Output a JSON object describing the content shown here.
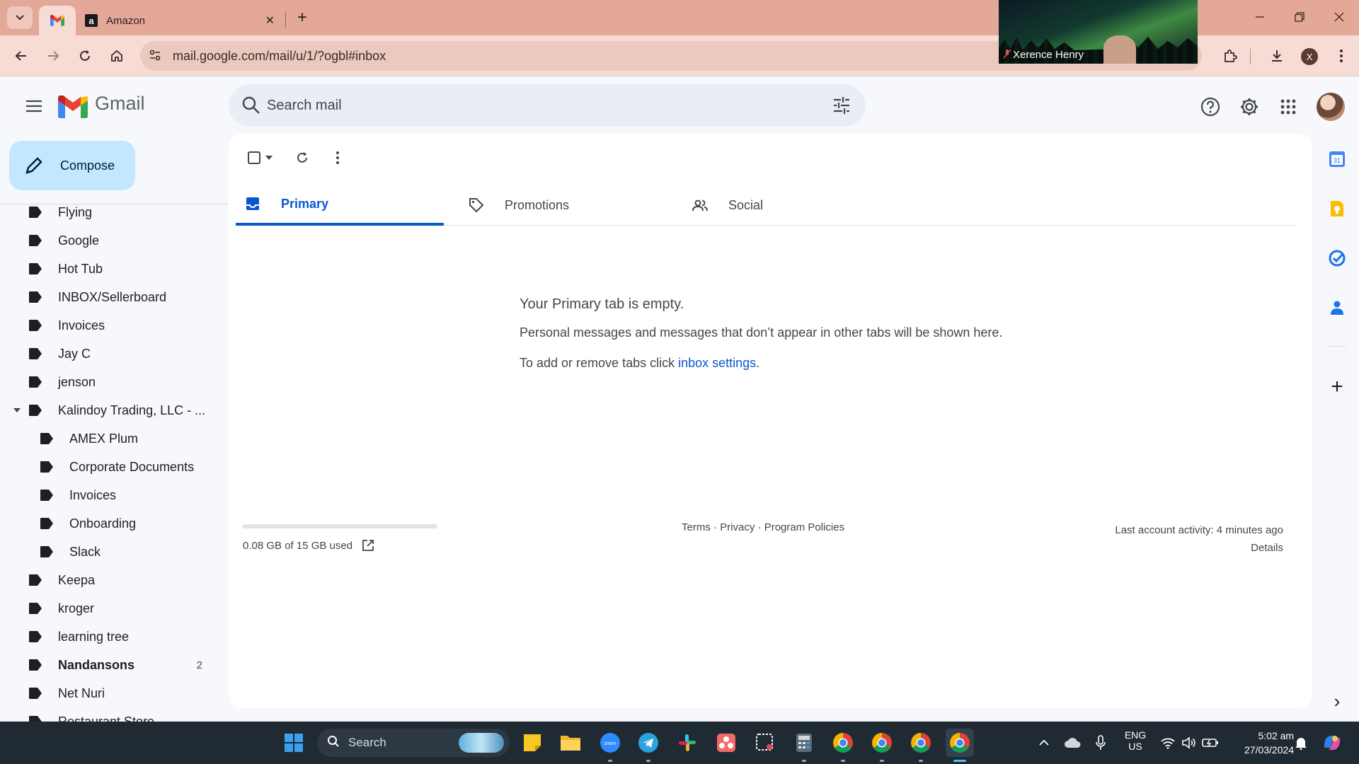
{
  "browser": {
    "tabs": [
      {
        "title": "",
        "favicon": "gmail-icon",
        "active": true
      },
      {
        "title": "Amazon",
        "favicon": "amazon-icon",
        "active": false
      }
    ],
    "tab_close": "✕",
    "new_tab": "+",
    "url": "mail.google.com/mail/u/1/?ogbl#inbox",
    "profile_initial": "X",
    "tab_color": "#e4a898",
    "toolbar_color": "#f6dcd4"
  },
  "video_call": {
    "participant": "Xerence Henry",
    "mic_status": "muted"
  },
  "gmail": {
    "product_name": "Gmail",
    "search_placeholder": "Search mail",
    "compose_label": "Compose",
    "labels": [
      {
        "name": "Flying",
        "count": "",
        "bold": false,
        "nested": false
      },
      {
        "name": "Google",
        "count": "",
        "bold": false,
        "nested": false
      },
      {
        "name": "Hot Tub",
        "count": "",
        "bold": false,
        "nested": false
      },
      {
        "name": "INBOX/Sellerboard",
        "count": "",
        "bold": false,
        "nested": false
      },
      {
        "name": "Invoices",
        "count": "",
        "bold": false,
        "nested": false
      },
      {
        "name": "Jay C",
        "count": "",
        "bold": false,
        "nested": false
      },
      {
        "name": "jenson",
        "count": "",
        "bold": false,
        "nested": false
      },
      {
        "name": "Kalindoy Trading, LLC - ...",
        "count": "",
        "bold": false,
        "nested": false,
        "expanded": true
      },
      {
        "name": "AMEX Plum",
        "count": "",
        "bold": false,
        "nested": true
      },
      {
        "name": "Corporate Documents",
        "count": "",
        "bold": false,
        "nested": true
      },
      {
        "name": "Invoices",
        "count": "",
        "bold": false,
        "nested": true
      },
      {
        "name": "Onboarding",
        "count": "",
        "bold": false,
        "nested": true
      },
      {
        "name": "Slack",
        "count": "",
        "bold": false,
        "nested": true
      },
      {
        "name": "Keepa",
        "count": "",
        "bold": false,
        "nested": false
      },
      {
        "name": "kroger",
        "count": "",
        "bold": false,
        "nested": false
      },
      {
        "name": "learning tree",
        "count": "",
        "bold": false,
        "nested": false
      },
      {
        "name": "Nandansons",
        "count": "2",
        "bold": true,
        "nested": false
      },
      {
        "name": "Net Nuri",
        "count": "",
        "bold": false,
        "nested": false
      },
      {
        "name": "Restaurant Store",
        "count": "",
        "bold": false,
        "nested": false
      }
    ],
    "tabs": [
      {
        "label": "Primary",
        "icon": "inbox-icon",
        "active": true
      },
      {
        "label": "Promotions",
        "icon": "tag-icon",
        "active": false
      },
      {
        "label": "Social",
        "icon": "people-icon",
        "active": false
      }
    ],
    "empty_state": {
      "title": "Your Primary tab is empty.",
      "description": "Personal messages and messages that don’t appear in other tabs will be shown here.",
      "hint_prefix": "To add or remove tabs click ",
      "hint_link": "inbox settings",
      "hint_suffix": "."
    },
    "storage": {
      "used_text": "0.08 GB of 15 GB used",
      "fraction": 0.005
    },
    "footer": {
      "links": [
        "Terms",
        "Privacy",
        "Program Policies"
      ],
      "separator": " · ",
      "activity": "Last account activity: 4 minutes ago",
      "details": "Details"
    },
    "accent_color": "#0b57d0",
    "compose_color": "#c2e7ff"
  },
  "side_panel": {
    "apps": [
      "calendar-icon",
      "keep-icon",
      "tasks-icon",
      "contacts-icon"
    ],
    "calendar_day": "31",
    "add": "+",
    "expand": "›"
  },
  "taskbar": {
    "search_label": "Search",
    "language": "ENG",
    "region": "US",
    "time": "5:02 am",
    "date": "27/03/2024"
  }
}
